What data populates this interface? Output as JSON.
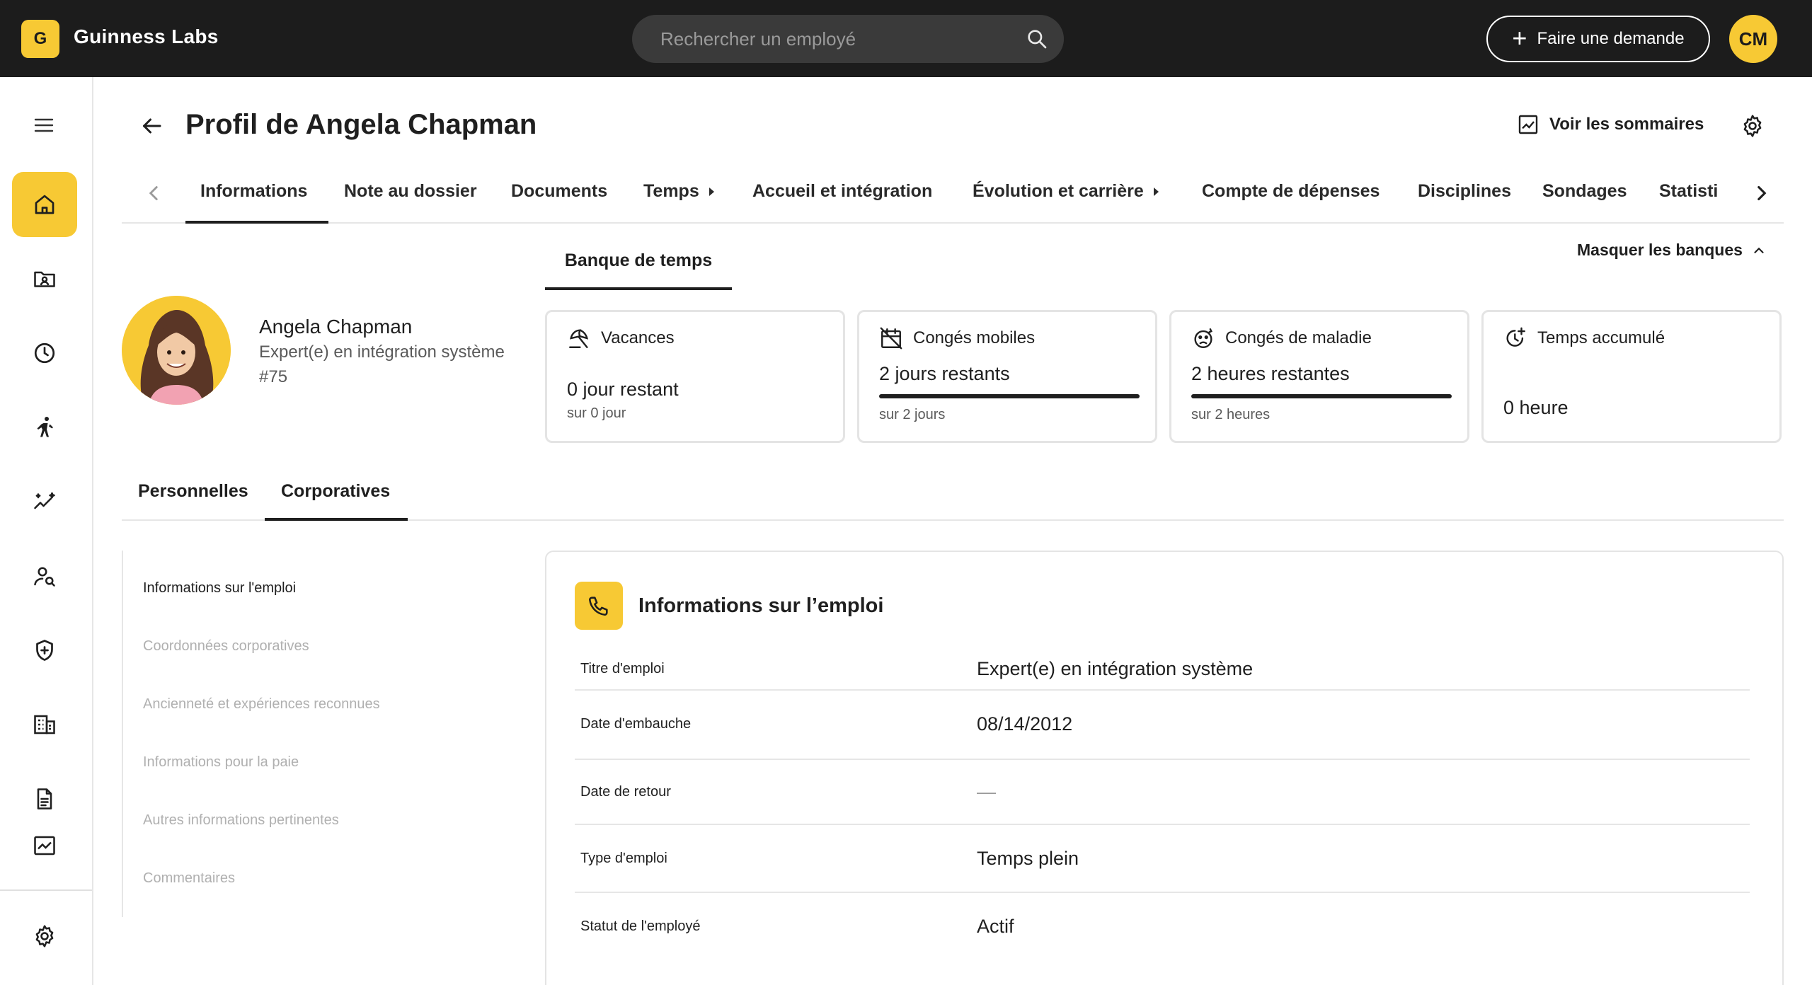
{
  "topbar": {
    "logo_letter": "G",
    "brand": "Guinness Labs",
    "search_placeholder": "Rechercher un employé",
    "request_label": "Faire une demande",
    "user_initials": "CM"
  },
  "sidebar": {
    "items": [
      {
        "name": "home-icon",
        "active": true
      },
      {
        "name": "folder-person-icon"
      },
      {
        "name": "clock-icon"
      },
      {
        "name": "person-activity-icon"
      },
      {
        "name": "sparkle-trend-icon"
      },
      {
        "name": "person-search-icon"
      },
      {
        "name": "shield-plus-icon"
      },
      {
        "name": "building-icon"
      },
      {
        "name": "document-icon"
      },
      {
        "name": "chart-icon"
      },
      {
        "name": "settings-icon"
      }
    ]
  },
  "header": {
    "title": "Profil de Angela Chapman",
    "summaries_label": "Voir les sommaires"
  },
  "tabs": [
    {
      "label": "Informations",
      "active": true
    },
    {
      "label": "Note au dossier"
    },
    {
      "label": "Documents"
    },
    {
      "label": "Temps",
      "submenu": true
    },
    {
      "label": "Accueil et intégration"
    },
    {
      "label": "Évolution et carrière",
      "submenu": true
    },
    {
      "label": "Compte de dépenses"
    },
    {
      "label": "Disciplines"
    },
    {
      "label": "Sondages"
    },
    {
      "label": "Statisti"
    }
  ],
  "profile": {
    "name": "Angela Chapman",
    "role": "Expert(e) en intégration système",
    "number": "#75"
  },
  "bank": {
    "tab_label": "Banque de temps",
    "hide_label": "Masquer les banques",
    "cards": [
      {
        "title": "Vacances",
        "icon": "beach-umbrella-icon",
        "value": "0 jour restant",
        "sub": "sur 0 jour",
        "progress": null
      },
      {
        "title": "Congés mobiles",
        "icon": "calendar-off-icon",
        "value": "2 jours restants",
        "sub": "sur 2 jours",
        "progress": 1.0
      },
      {
        "title": "Congés de maladie",
        "icon": "sick-face-icon",
        "value": "2 heures restantes",
        "sub": "sur 2 heures",
        "progress": 1.0
      },
      {
        "title": "Temps accumulé",
        "icon": "clock-plus-icon",
        "value": "0 heure",
        "sub": "",
        "progress": null
      }
    ]
  },
  "subtabs": [
    {
      "label": "Personnelles"
    },
    {
      "label": "Corporatives",
      "active": true
    }
  ],
  "sections": [
    {
      "label": "Informations sur l'emploi",
      "active": true
    },
    {
      "label": "Coordonnées corporatives"
    },
    {
      "label": "Ancienneté et expériences reconnues"
    },
    {
      "label": "Informations pour la paie"
    },
    {
      "label": "Autres informations pertinentes"
    },
    {
      "label": "Commentaires"
    }
  ],
  "job_info": {
    "title": "Informations sur l’emploi",
    "rows": [
      {
        "label": "Titre d'emploi",
        "value": "Expert(e) en intégration système"
      },
      {
        "label": "Date d'embauche",
        "value": "08/14/2012"
      },
      {
        "label": "Date de retour",
        "value": "—"
      },
      {
        "label": "Type d'emploi",
        "value": "Temps plein"
      },
      {
        "label": "Statut de l'employé",
        "value": "Actif"
      }
    ]
  },
  "colors": {
    "accent": "#f7c934",
    "topbar_bg": "#1c1c1c",
    "text": "#1f1f1f",
    "muted": "#b0b0b0"
  }
}
